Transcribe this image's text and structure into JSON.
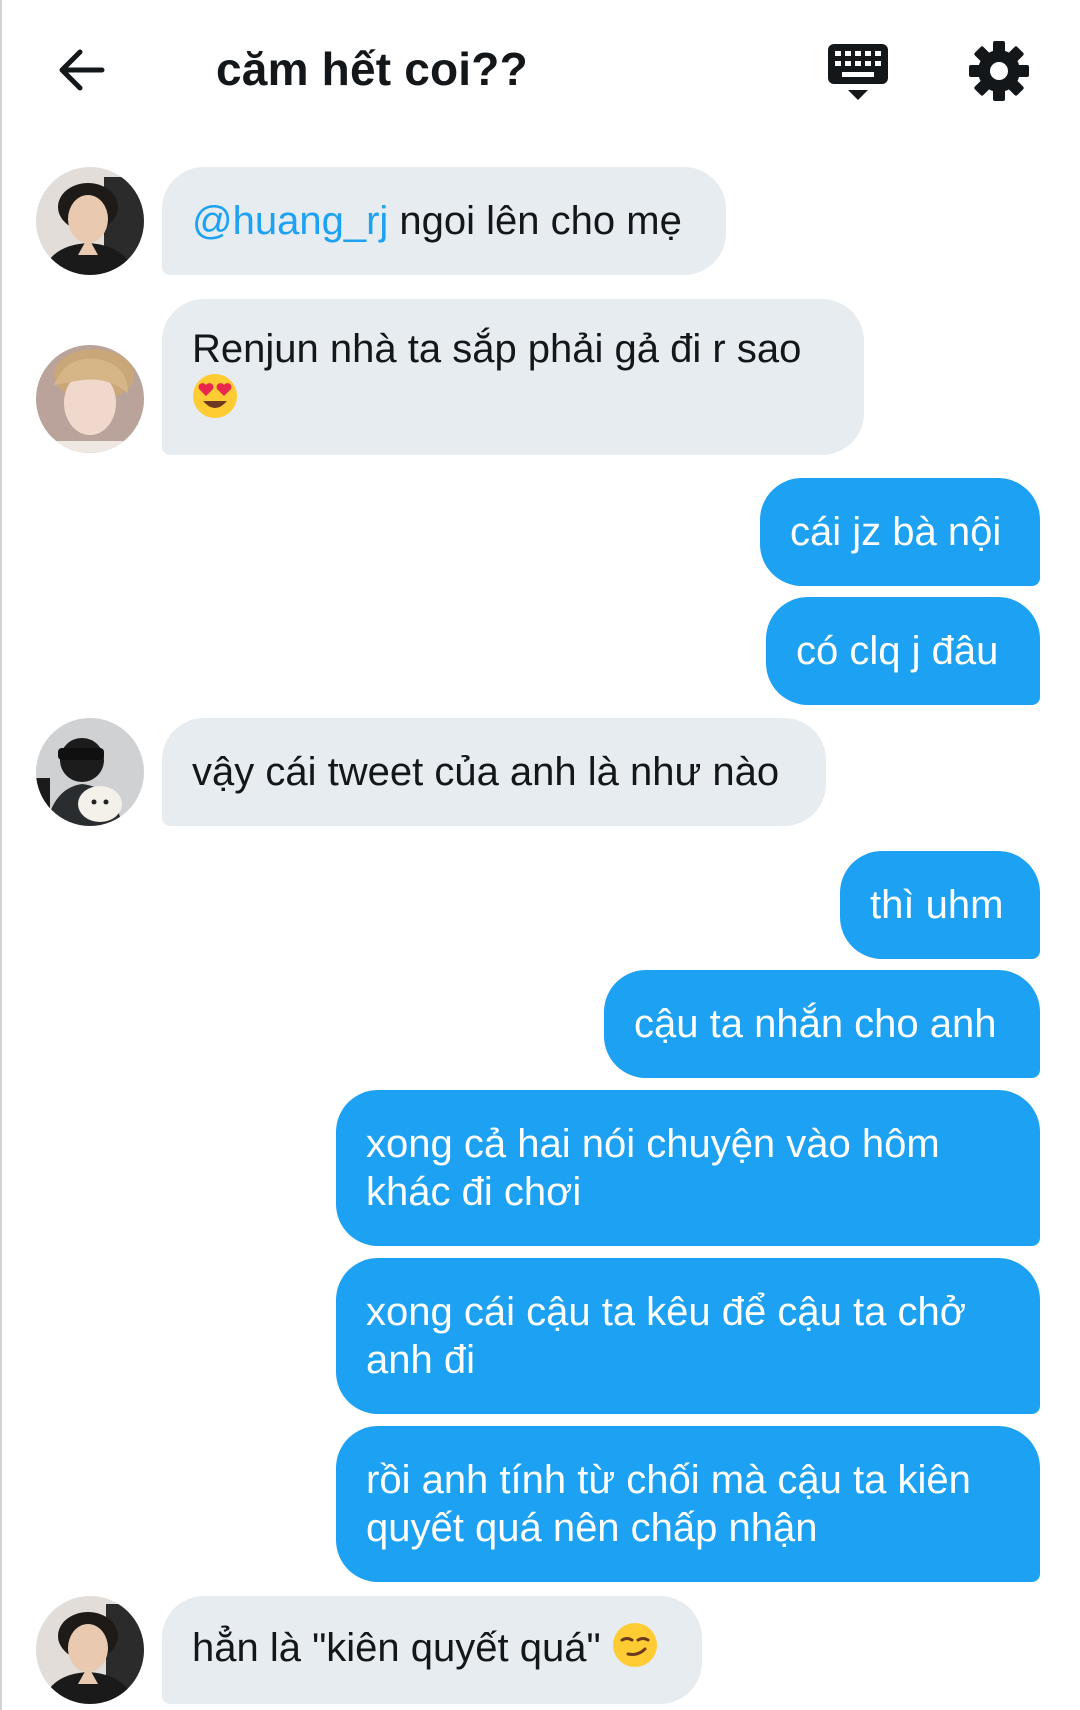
{
  "header": {
    "title": "căm hết coi??",
    "icons": [
      "back-arrow-icon",
      "keyboard-icon",
      "gear-icon"
    ]
  },
  "colors": {
    "incoming_bubble": "#e6ecf0",
    "outgoing_bubble": "#1da1f2",
    "mention": "#1da1f2"
  },
  "messages": [
    {
      "dir": "in",
      "mention": "@huang_rj",
      "text": " ngoi lên cho mẹ"
    },
    {
      "dir": "in",
      "text": "Renjun nhà ta sắp phải gả đi r sao",
      "emoji": "heart-eyes-emoji"
    },
    {
      "dir": "out",
      "text": "cái jz bà nội"
    },
    {
      "dir": "out",
      "text": "có clq j đâu"
    },
    {
      "dir": "in",
      "text": "vậy cái tweet của anh là như nào"
    },
    {
      "dir": "out",
      "text": "thì uhm"
    },
    {
      "dir": "out",
      "text": "cậu ta nhắn cho anh"
    },
    {
      "dir": "out",
      "text": "xong cả hai nói chuyện vào hôm khác đi chơi"
    },
    {
      "dir": "out",
      "text": "xong cái cậu ta kêu để cậu ta chở anh đi"
    },
    {
      "dir": "out",
      "text": "rồi anh tính từ chối mà cậu ta kiên quyết quá nên chấp nhận"
    },
    {
      "dir": "in",
      "text": "hẳn là \"kiên quyết quá\" ",
      "emoji": "smirk-emoji"
    }
  ]
}
